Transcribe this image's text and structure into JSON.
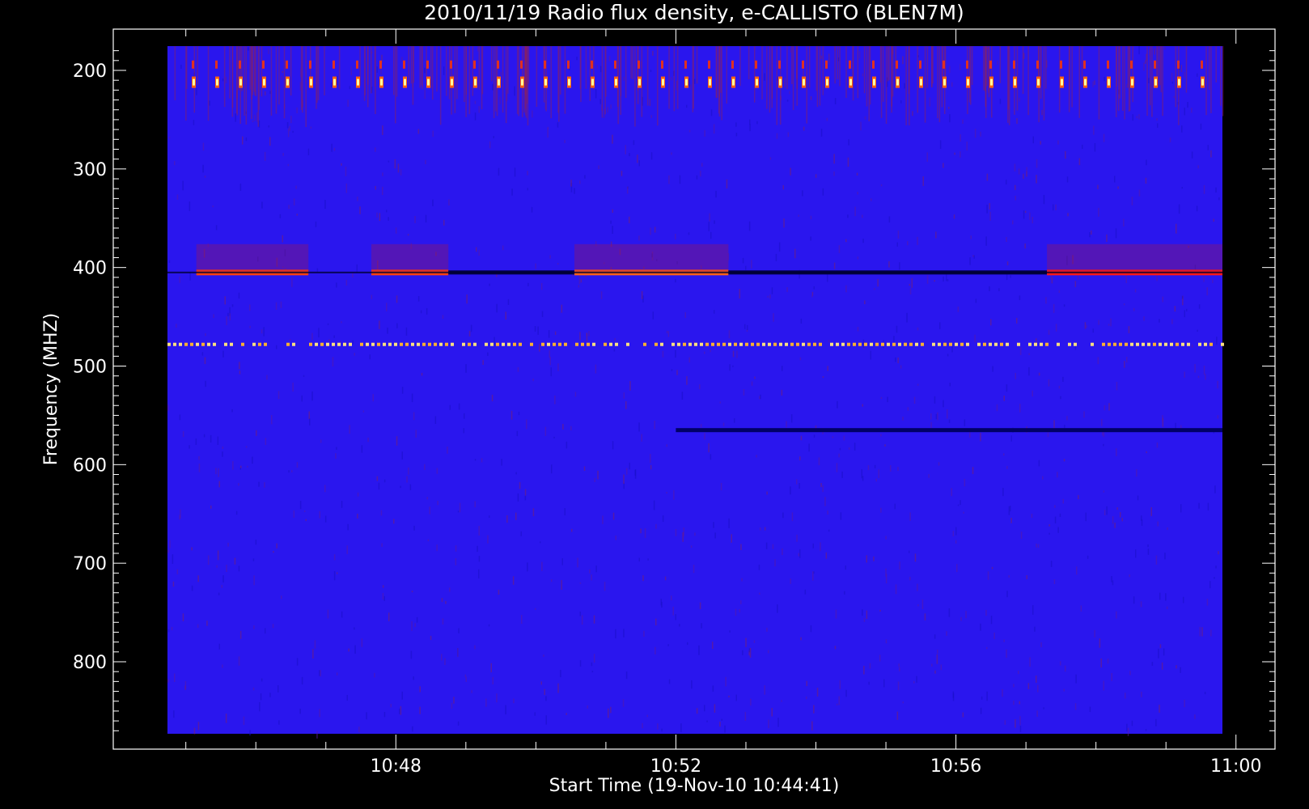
{
  "chart_data": {
    "type": "heatmap",
    "title": "2010/11/19  Radio flux density, e-CALLISTO (BLEN7M)",
    "xlabel": "Start Time (19-Nov-10 10:44:41)",
    "ylabel": "Frequency (MHZ)",
    "x_ticks": [
      "10:48",
      "10:52",
      "10:56",
      "11:00"
    ],
    "y_ticks": [
      200,
      300,
      400,
      500,
      600,
      700,
      800
    ],
    "x_range_minutes": [
      44.68,
      59.98
    ],
    "y_range_mhz": [
      175,
      873
    ],
    "y_axis_inverted": true,
    "colormap": [
      "#000000",
      "#0000ff",
      "#ff0000",
      "#ffff00",
      "#ffffff"
    ],
    "background_level_color": "#2a16ee",
    "features": [
      {
        "name": "400 MHz carrier segment",
        "freq_mhz": 405,
        "t_start_min": 45.15,
        "t_end_min": 46.75,
        "color": "#ff4010"
      },
      {
        "name": "400 MHz carrier segment",
        "freq_mhz": 405,
        "t_start_min": 47.65,
        "t_end_min": 48.75,
        "color": "#ff4010"
      },
      {
        "name": "400 MHz carrier segment",
        "freq_mhz": 405,
        "t_start_min": 50.55,
        "t_end_min": 52.75,
        "color": "#ff6018"
      },
      {
        "name": "400 MHz carrier segment",
        "freq_mhz": 405,
        "t_start_min": 57.3,
        "t_end_min": 59.98,
        "color": "#ff1818"
      },
      {
        "name": "dark band",
        "freq_mhz": 405,
        "t_start_min": 48.75,
        "t_end_min": 50.55,
        "color": "#000044"
      },
      {
        "name": "dark band",
        "freq_mhz": 405,
        "t_start_min": 52.75,
        "t_end_min": 57.3,
        "color": "#000044"
      },
      {
        "name": "dark band",
        "freq_mhz": 565,
        "t_start_min": 52.0,
        "t_end_min": 59.98,
        "color": "#000066"
      },
      {
        "name": "periodic bursts",
        "freq_mhz": 212,
        "pattern": "yellow-white pulses roughly every 20 s"
      },
      {
        "name": "periodic bursts",
        "freq_mhz": 478,
        "pattern": "dashed yellow-orange line across full span"
      }
    ]
  }
}
